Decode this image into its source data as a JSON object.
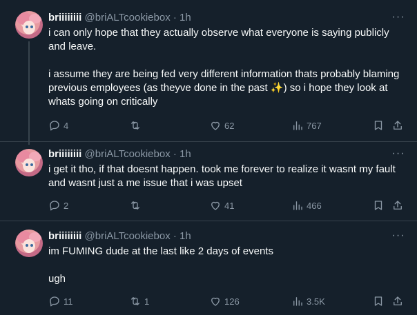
{
  "tweets": [
    {
      "name": "briiiiiiii",
      "handle": "@briALTcookiebox",
      "time": "1h",
      "paragraphs": [
        "i can only hope that they actually observe what everyone is saying publicly and leave.",
        "i assume they are being fed very different information thats probably blaming previous employees (as theyve done in the past",
        ") so i hope they look at whats going on critically"
      ],
      "emoji": "✨",
      "replies": "4",
      "retweets": "",
      "likes": "62",
      "views": "767"
    },
    {
      "name": "briiiiiiii",
      "handle": "@briALTcookiebox",
      "time": "1h",
      "paragraphs": [
        "i get it tho, if that doesnt happen. took me forever to realize it wasnt my fault and wasnt just a me issue that i was upset"
      ],
      "replies": "2",
      "retweets": "",
      "likes": "41",
      "views": "466"
    },
    {
      "name": "briiiiiiii",
      "handle": "@briALTcookiebox",
      "time": "1h",
      "paragraphs": [
        "im FUMING dude at the last like 2 days of events",
        "ugh"
      ],
      "replies": "11",
      "retweets": "1",
      "likes": "126",
      "views": "3.5K"
    }
  ],
  "ui": {
    "separator": " · ",
    "more_glyph": "···",
    "icons": [
      "reply-icon",
      "retweet-icon",
      "like-icon",
      "views-icon",
      "bookmark-icon",
      "share-icon"
    ],
    "colors": {
      "background": "#15202b",
      "text": "#f7f9f9",
      "muted": "#8b98a5",
      "border": "#38444d"
    }
  }
}
